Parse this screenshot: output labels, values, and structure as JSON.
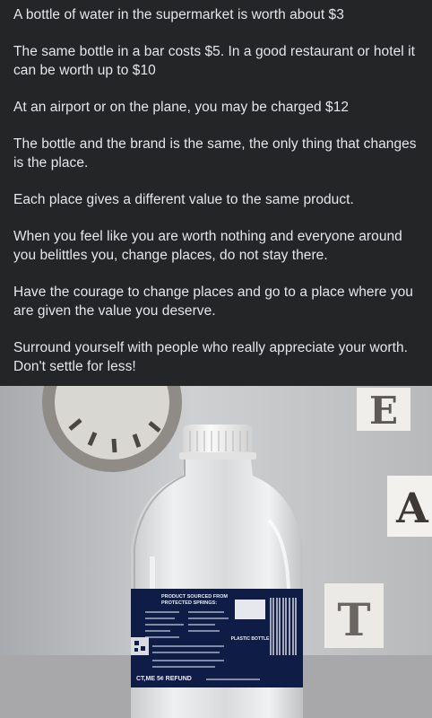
{
  "post": {
    "paragraphs": [
      "A bottle of water in the supermarket is worth about $3",
      "The same bottle in a bar costs $5. In a good restaurant or hotel it can be worth up to $10",
      "At an airport or on the plane, you may be charged $12",
      "The bottle and the brand is the same, the only thing that changes is the place.",
      "Each place gives a different value to the same product.",
      "When you feel like you are worth nothing and everyone around you belittles you, change places, do not stay there.",
      "Have the courage to change places and go to a place where you are given the value you deserve.",
      "Surround yourself with people who really appreciate your worth. Don't settle for less!"
    ]
  },
  "photo": {
    "wall_letters": [
      "E",
      "A",
      "T"
    ],
    "label": {
      "header_line1": "PRODUCT SOURCED FROM",
      "header_line2": "PROTECTED SPRINGS:",
      "badge": "PLASTIC BOTTLE",
      "refund": "CT,ME 5¢ REFUND"
    }
  }
}
